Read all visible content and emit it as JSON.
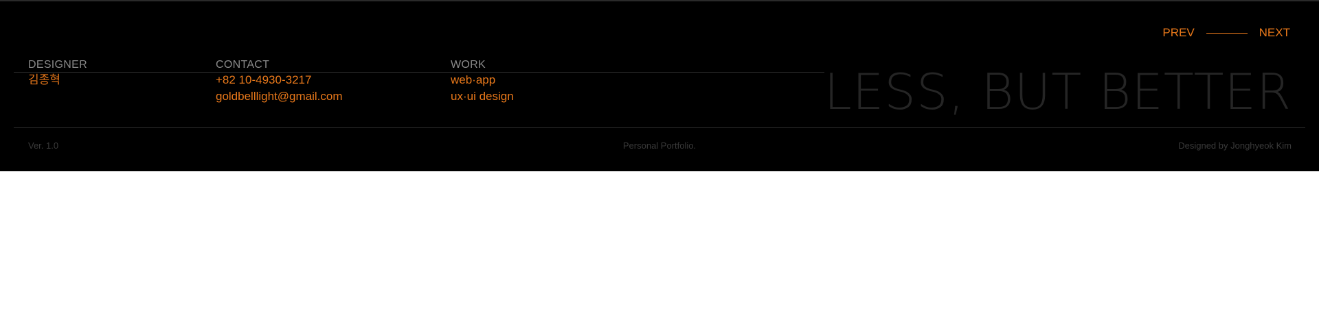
{
  "nav": {
    "prev_label": "PREV",
    "next_label": "NEXT"
  },
  "designer": {
    "heading": "DESIGNER",
    "name": "김종혁"
  },
  "contact": {
    "heading": "CONTACT",
    "phone": "+82 10-4930-3217",
    "email": "goldbelllight@gmail.com"
  },
  "work": {
    "heading": "WORK",
    "items": [
      "web·app",
      "ux·ui design"
    ]
  },
  "slogan": "LESS, BUT BETTER",
  "bottom": {
    "version": "Ver. 1.0",
    "center": "Personal Portfolio.",
    "credit": "Designed by Jonghyeok Kim"
  },
  "colors": {
    "accent": "#e8781a",
    "background": "#000000",
    "muted": "#8a8a8a"
  }
}
